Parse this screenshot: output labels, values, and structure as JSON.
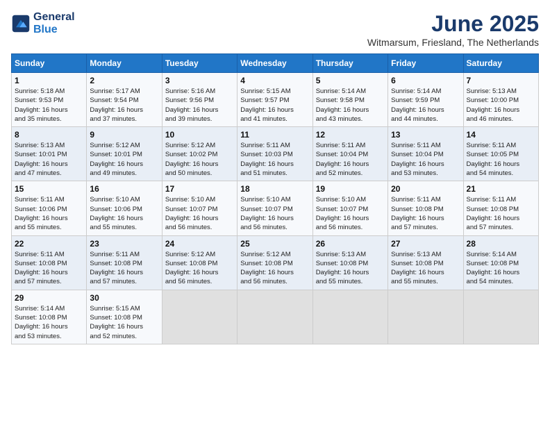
{
  "header": {
    "logo_line1": "General",
    "logo_line2": "Blue",
    "title": "June 2025",
    "subtitle": "Witmarsum, Friesland, The Netherlands"
  },
  "weekdays": [
    "Sunday",
    "Monday",
    "Tuesday",
    "Wednesday",
    "Thursday",
    "Friday",
    "Saturday"
  ],
  "weeks": [
    [
      {
        "day": "1",
        "info": "Sunrise: 5:18 AM\nSunset: 9:53 PM\nDaylight: 16 hours\nand 35 minutes."
      },
      {
        "day": "2",
        "info": "Sunrise: 5:17 AM\nSunset: 9:54 PM\nDaylight: 16 hours\nand 37 minutes."
      },
      {
        "day": "3",
        "info": "Sunrise: 5:16 AM\nSunset: 9:56 PM\nDaylight: 16 hours\nand 39 minutes."
      },
      {
        "day": "4",
        "info": "Sunrise: 5:15 AM\nSunset: 9:57 PM\nDaylight: 16 hours\nand 41 minutes."
      },
      {
        "day": "5",
        "info": "Sunrise: 5:14 AM\nSunset: 9:58 PM\nDaylight: 16 hours\nand 43 minutes."
      },
      {
        "day": "6",
        "info": "Sunrise: 5:14 AM\nSunset: 9:59 PM\nDaylight: 16 hours\nand 44 minutes."
      },
      {
        "day": "7",
        "info": "Sunrise: 5:13 AM\nSunset: 10:00 PM\nDaylight: 16 hours\nand 46 minutes."
      }
    ],
    [
      {
        "day": "8",
        "info": "Sunrise: 5:13 AM\nSunset: 10:01 PM\nDaylight: 16 hours\nand 47 minutes."
      },
      {
        "day": "9",
        "info": "Sunrise: 5:12 AM\nSunset: 10:01 PM\nDaylight: 16 hours\nand 49 minutes."
      },
      {
        "day": "10",
        "info": "Sunrise: 5:12 AM\nSunset: 10:02 PM\nDaylight: 16 hours\nand 50 minutes."
      },
      {
        "day": "11",
        "info": "Sunrise: 5:11 AM\nSunset: 10:03 PM\nDaylight: 16 hours\nand 51 minutes."
      },
      {
        "day": "12",
        "info": "Sunrise: 5:11 AM\nSunset: 10:04 PM\nDaylight: 16 hours\nand 52 minutes."
      },
      {
        "day": "13",
        "info": "Sunrise: 5:11 AM\nSunset: 10:04 PM\nDaylight: 16 hours\nand 53 minutes."
      },
      {
        "day": "14",
        "info": "Sunrise: 5:11 AM\nSunset: 10:05 PM\nDaylight: 16 hours\nand 54 minutes."
      }
    ],
    [
      {
        "day": "15",
        "info": "Sunrise: 5:11 AM\nSunset: 10:06 PM\nDaylight: 16 hours\nand 55 minutes."
      },
      {
        "day": "16",
        "info": "Sunrise: 5:10 AM\nSunset: 10:06 PM\nDaylight: 16 hours\nand 55 minutes."
      },
      {
        "day": "17",
        "info": "Sunrise: 5:10 AM\nSunset: 10:07 PM\nDaylight: 16 hours\nand 56 minutes."
      },
      {
        "day": "18",
        "info": "Sunrise: 5:10 AM\nSunset: 10:07 PM\nDaylight: 16 hours\nand 56 minutes."
      },
      {
        "day": "19",
        "info": "Sunrise: 5:10 AM\nSunset: 10:07 PM\nDaylight: 16 hours\nand 56 minutes."
      },
      {
        "day": "20",
        "info": "Sunrise: 5:11 AM\nSunset: 10:08 PM\nDaylight: 16 hours\nand 57 minutes."
      },
      {
        "day": "21",
        "info": "Sunrise: 5:11 AM\nSunset: 10:08 PM\nDaylight: 16 hours\nand 57 minutes."
      }
    ],
    [
      {
        "day": "22",
        "info": "Sunrise: 5:11 AM\nSunset: 10:08 PM\nDaylight: 16 hours\nand 57 minutes."
      },
      {
        "day": "23",
        "info": "Sunrise: 5:11 AM\nSunset: 10:08 PM\nDaylight: 16 hours\nand 57 minutes."
      },
      {
        "day": "24",
        "info": "Sunrise: 5:12 AM\nSunset: 10:08 PM\nDaylight: 16 hours\nand 56 minutes."
      },
      {
        "day": "25",
        "info": "Sunrise: 5:12 AM\nSunset: 10:08 PM\nDaylight: 16 hours\nand 56 minutes."
      },
      {
        "day": "26",
        "info": "Sunrise: 5:13 AM\nSunset: 10:08 PM\nDaylight: 16 hours\nand 55 minutes."
      },
      {
        "day": "27",
        "info": "Sunrise: 5:13 AM\nSunset: 10:08 PM\nDaylight: 16 hours\nand 55 minutes."
      },
      {
        "day": "28",
        "info": "Sunrise: 5:14 AM\nSunset: 10:08 PM\nDaylight: 16 hours\nand 54 minutes."
      }
    ],
    [
      {
        "day": "29",
        "info": "Sunrise: 5:14 AM\nSunset: 10:08 PM\nDaylight: 16 hours\nand 53 minutes."
      },
      {
        "day": "30",
        "info": "Sunrise: 5:15 AM\nSunset: 10:08 PM\nDaylight: 16 hours\nand 52 minutes."
      },
      {
        "day": "",
        "info": ""
      },
      {
        "day": "",
        "info": ""
      },
      {
        "day": "",
        "info": ""
      },
      {
        "day": "",
        "info": ""
      },
      {
        "day": "",
        "info": ""
      }
    ]
  ]
}
